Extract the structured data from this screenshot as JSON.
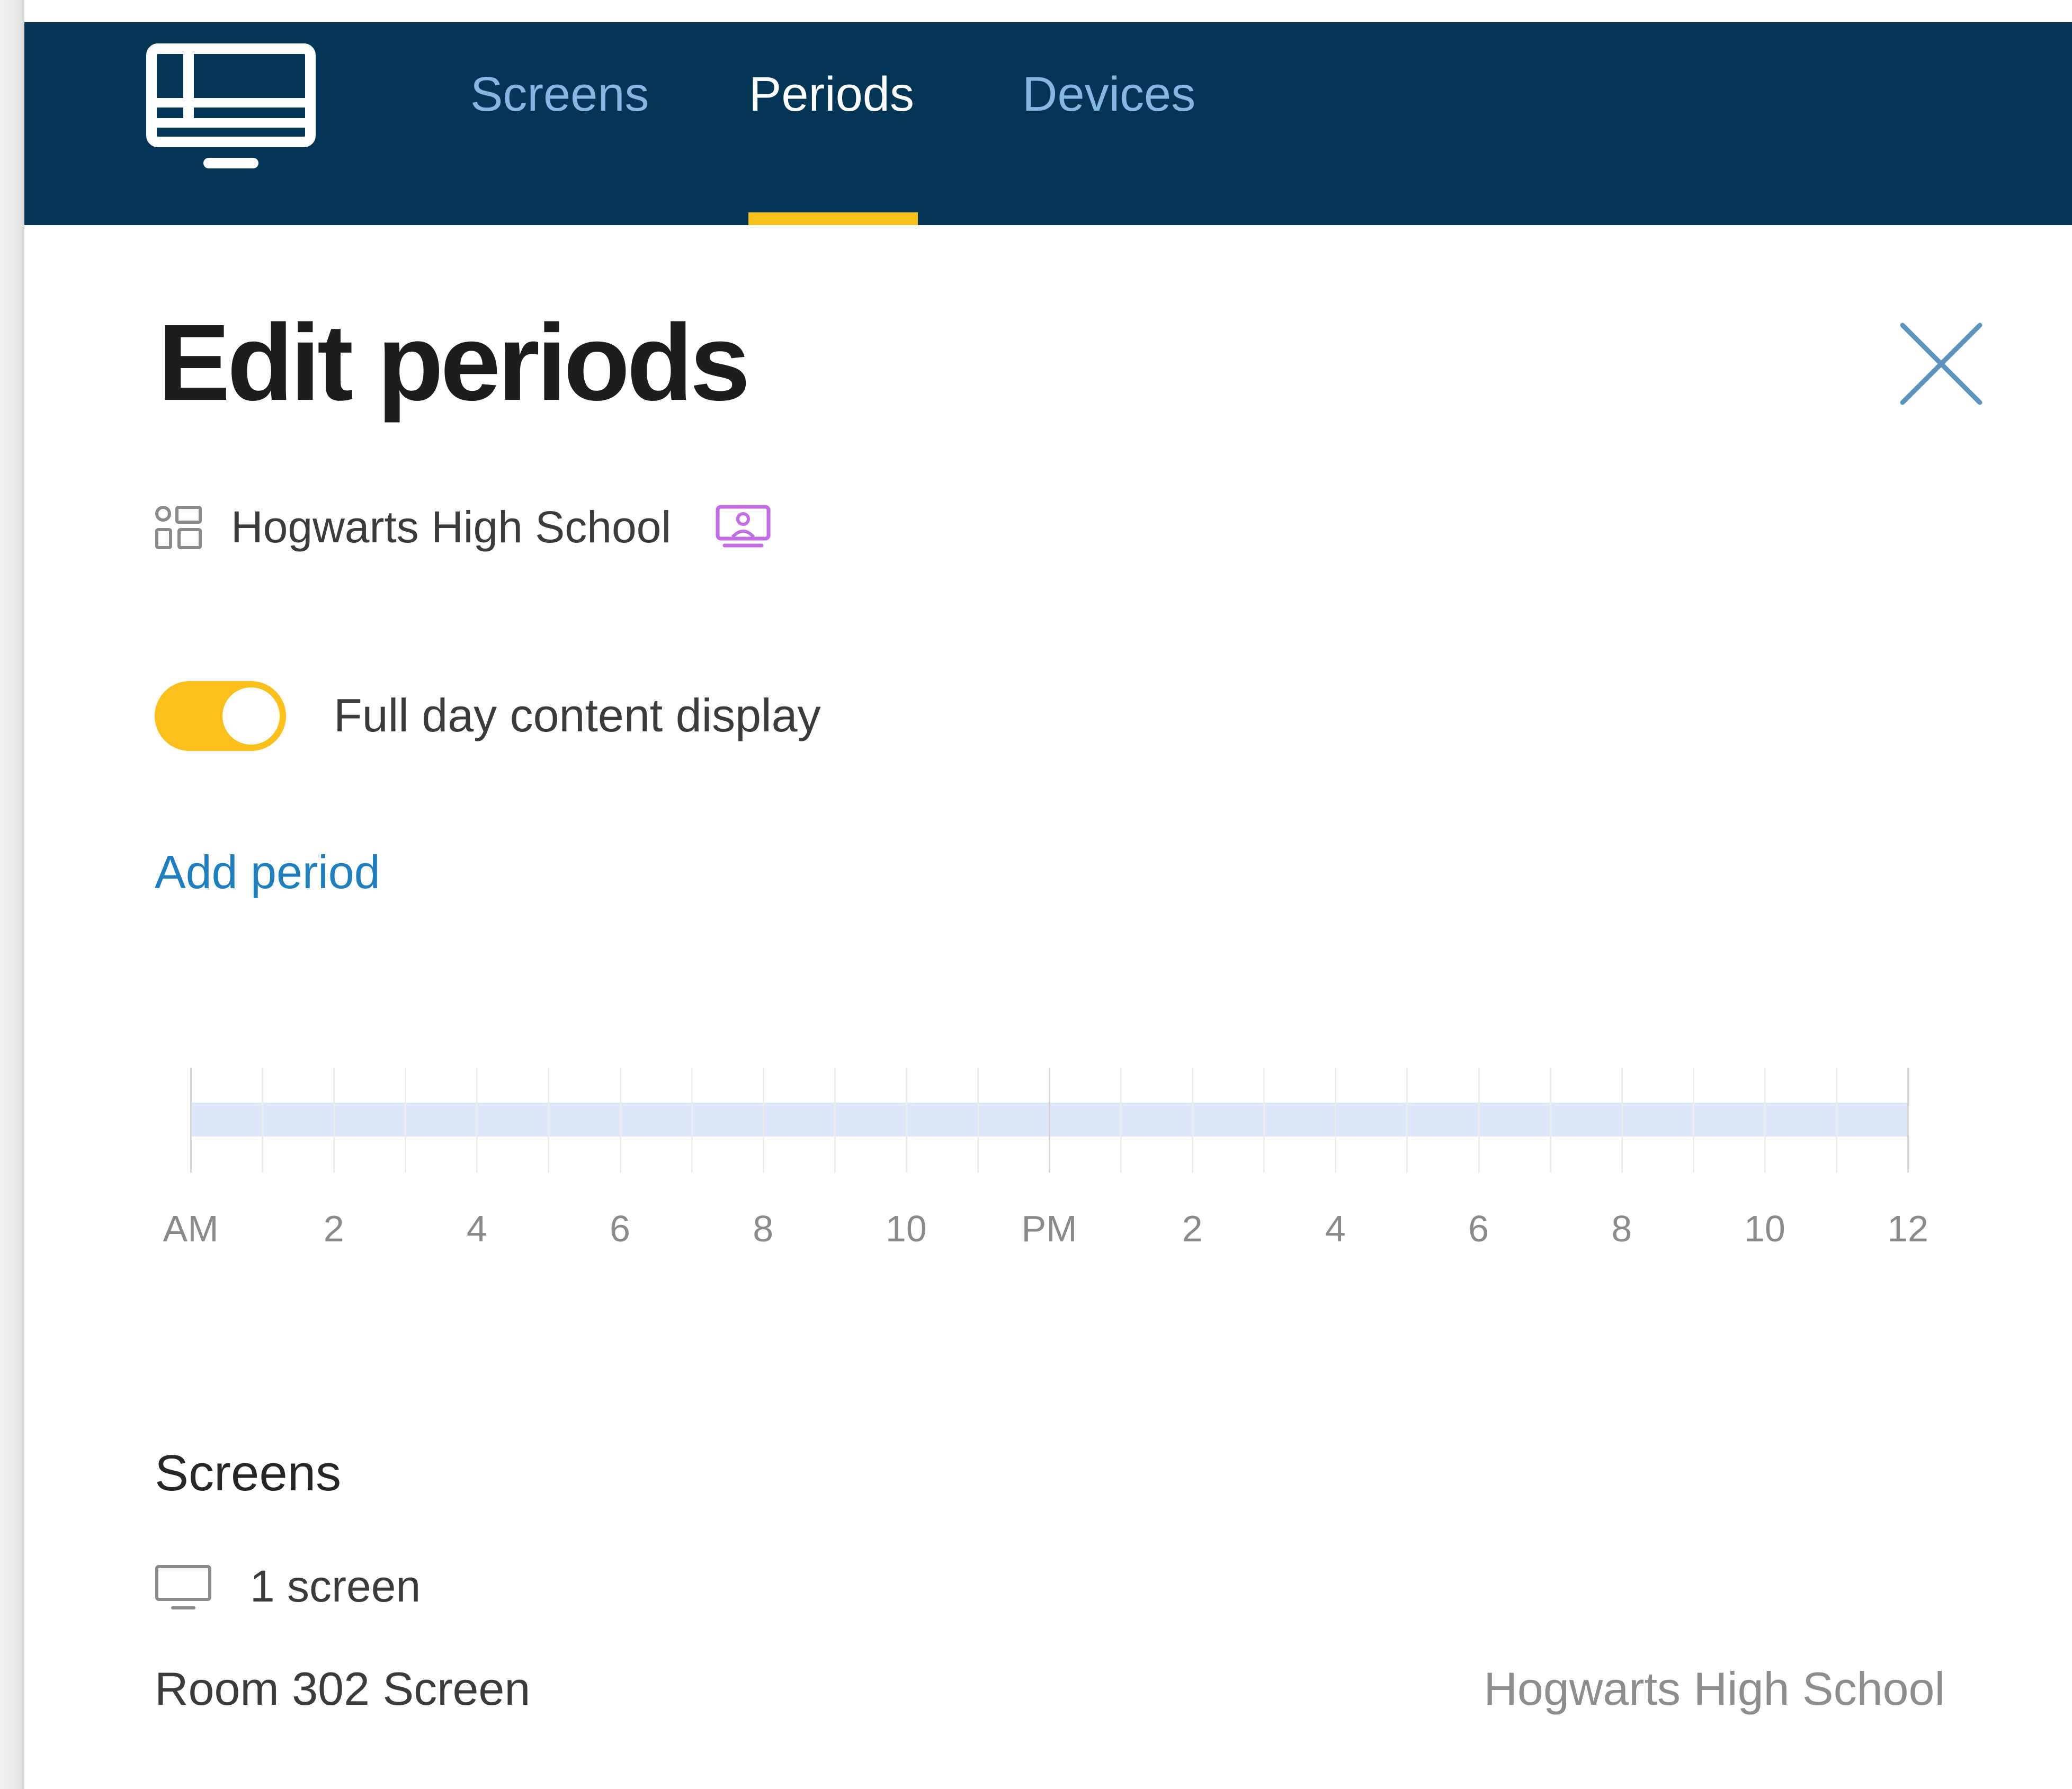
{
  "nav": {
    "logo_icon": "screen-layout-icon",
    "tabs": [
      {
        "label": "Screens",
        "active": false
      },
      {
        "label": "Periods",
        "active": true
      },
      {
        "label": "Devices",
        "active": false
      }
    ],
    "colors": {
      "background": "#023556",
      "active_underline": "#f8c21b",
      "inactive_text": "#84b8e0"
    }
  },
  "panel": {
    "title": "Edit periods",
    "close_icon": "close-icon",
    "organization": {
      "icon": "grid-layout-icon",
      "name": "Hogwarts High School",
      "badge_icon": "presenter-screen-icon",
      "badge_color": "#c46ce6"
    },
    "full_day_toggle": {
      "label": "Full day content display",
      "on": true,
      "color": "#fcc01d"
    },
    "add_period_label": "Add period",
    "timeline": {
      "labels": [
        "AM",
        "2",
        "4",
        "6",
        "8",
        "10",
        "PM",
        "2",
        "4",
        "6",
        "8",
        "10",
        "12"
      ],
      "band_color": "#dde8fb"
    },
    "screens": {
      "heading": "Screens",
      "count_icon": "monitor-icon",
      "count_text": "1 screen",
      "items": [
        {
          "name": "Room 302 Screen",
          "organization": "Hogwarts High School"
        }
      ]
    }
  }
}
